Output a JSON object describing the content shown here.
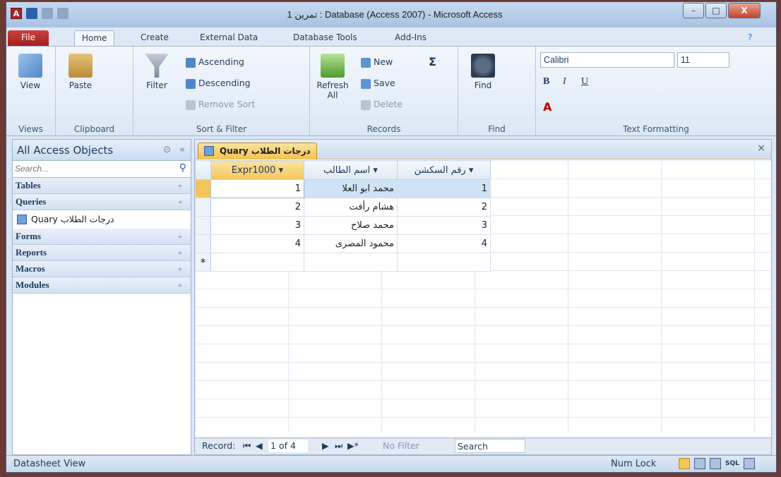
{
  "window": {
    "title": "تمرين 1 : Database (Access 2007)  -  Microsoft Access",
    "app_icon": "A",
    "min_label": "–",
    "max_label": "□",
    "close_label": "X"
  },
  "tabs": [
    "File",
    "Home",
    "Create",
    "External Data",
    "Database Tools",
    "Add-Ins"
  ],
  "ribbon": {
    "views": {
      "view": "View",
      "label": "Views"
    },
    "clipboard": {
      "paste": "Paste",
      "label": "Clipboard"
    },
    "sort": {
      "filter": "Filter",
      "ascending": "Ascending",
      "descending": "Descending",
      "remove_sort": "Remove Sort",
      "label": "Sort & Filter"
    },
    "records": {
      "refresh": "Refresh",
      "refresh_all": "All",
      "new": "New",
      "save": "Save",
      "delete": "Delete",
      "totals": "Σ",
      "label": "Records"
    },
    "find": {
      "find": "Find",
      "label": "Find"
    },
    "text": {
      "font": "Calibri",
      "size": "11",
      "bold": "B",
      "italic": "I",
      "underline": "U",
      "label": "Text Formatting"
    }
  },
  "nav": {
    "header": "All Access Objects",
    "search_placeholder": "Search...",
    "categories": [
      {
        "label": "Tables",
        "expanded": false
      },
      {
        "label": "Queries",
        "expanded": true
      },
      {
        "label": "Forms",
        "expanded": false
      },
      {
        "label": "Reports",
        "expanded": false
      },
      {
        "label": "Macros",
        "expanded": false
      },
      {
        "label": "Modules",
        "expanded": false
      }
    ],
    "query_item": "Quary درجات الطلاب"
  },
  "document": {
    "tab": "Quary درجات الطلاب",
    "close": "×",
    "columns": [
      "Expr1000",
      "اسم الطالب",
      "رقم السكشن"
    ],
    "rows": [
      [
        "1",
        "محمد ابو العلا",
        "1"
      ],
      [
        "2",
        "هشام رأفت",
        "2"
      ],
      [
        "3",
        "محمد صلاح",
        "3"
      ],
      [
        "4",
        "محمود المصرى",
        "4"
      ]
    ],
    "new_row_marker": "*"
  },
  "record_nav": {
    "label": "Record:",
    "position": "1 of 4",
    "filter": "No Filter",
    "search": "Search"
  },
  "status": {
    "left": "Datasheet View",
    "num_lock": "Num Lock"
  }
}
